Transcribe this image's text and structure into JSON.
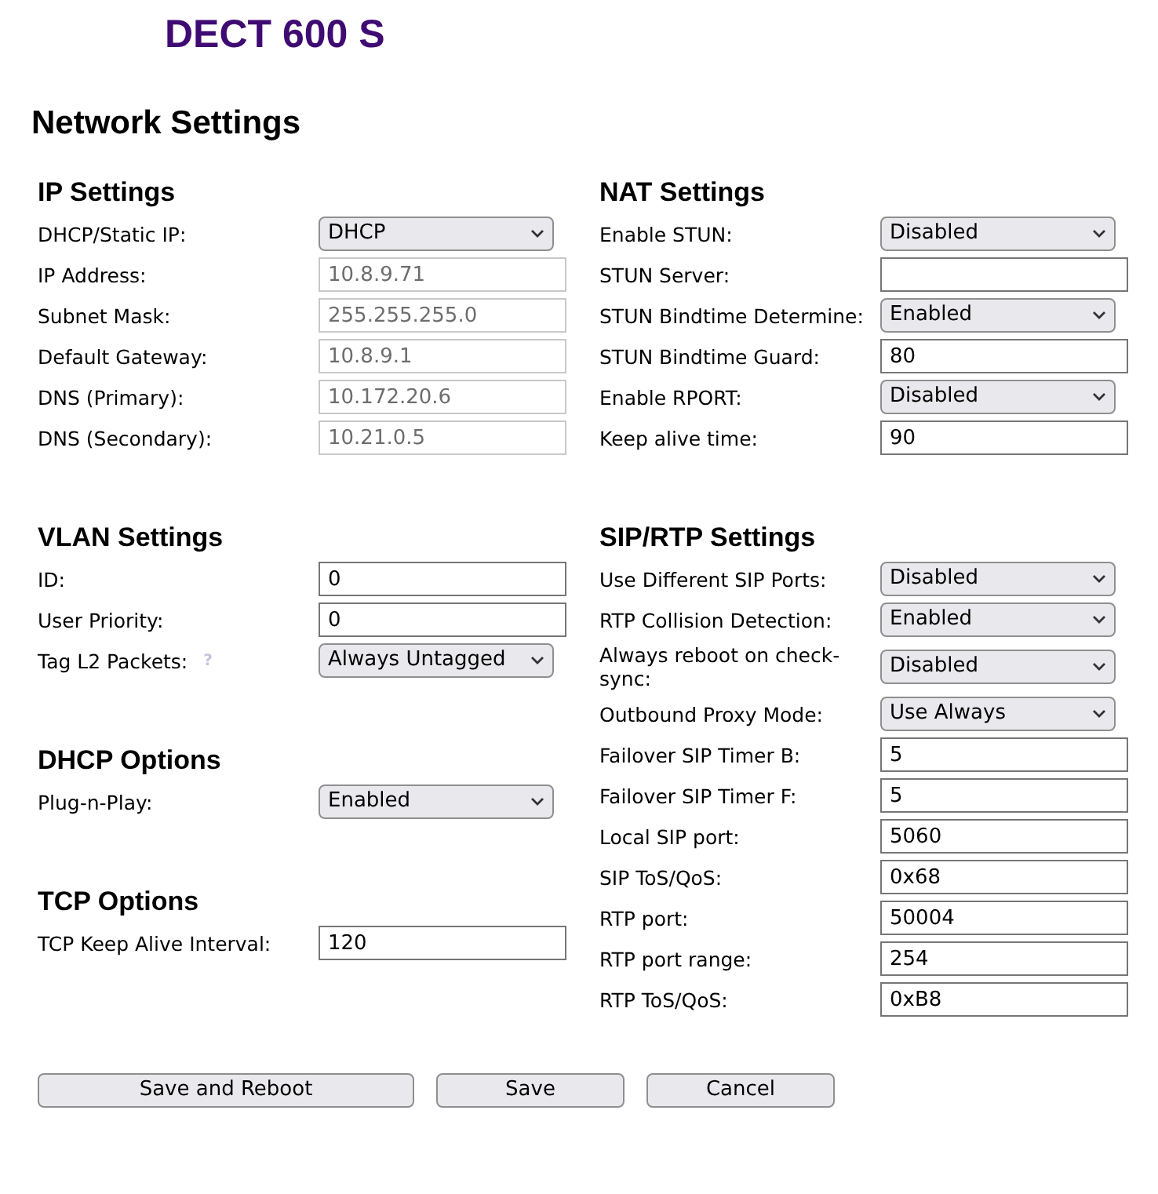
{
  "brand": "DECT 600 S",
  "page_title": "Network Settings",
  "columns": [
    [
      {
        "title": "IP Settings",
        "rows": [
          {
            "label": "DHCP/Static IP:",
            "kind": "select",
            "value": "DHCP"
          },
          {
            "label": "IP Address:",
            "kind": "input",
            "value": "10.8.9.71",
            "disabled": true
          },
          {
            "label": "Subnet Mask:",
            "kind": "input",
            "value": "255.255.255.0",
            "disabled": true
          },
          {
            "label": "Default Gateway:",
            "kind": "input",
            "value": "10.8.9.1",
            "disabled": true
          },
          {
            "label": "DNS (Primary):",
            "kind": "input",
            "value": "10.172.20.6",
            "disabled": true
          },
          {
            "label": "DNS (Secondary):",
            "kind": "input",
            "value": "10.21.0.5",
            "disabled": true
          }
        ]
      },
      {
        "title": "VLAN Settings",
        "rows": [
          {
            "label": "ID:",
            "kind": "input",
            "value": "0",
            "disabled": false
          },
          {
            "label": "User Priority:",
            "kind": "input",
            "value": "0",
            "disabled": false
          },
          {
            "label": "Tag L2 Packets:",
            "hint": "?",
            "kind": "select",
            "value": "Always Untagged"
          }
        ]
      },
      {
        "title": "DHCP Options",
        "rows": [
          {
            "label": "Plug-n-Play:",
            "kind": "select",
            "value": "Enabled"
          }
        ]
      },
      {
        "title": "TCP Options",
        "rows": [
          {
            "label": "TCP Keep Alive Interval:",
            "kind": "input",
            "value": "120",
            "disabled": false
          }
        ]
      }
    ],
    [
      {
        "title": "NAT Settings",
        "rows": [
          {
            "label": "Enable STUN:",
            "kind": "select",
            "value": "Disabled"
          },
          {
            "label": "STUN Server:",
            "kind": "input",
            "disabled": false
          },
          {
            "label": "STUN Bindtime Determine:",
            "kind": "select",
            "value": "Enabled"
          },
          {
            "label": "STUN Bindtime Guard:",
            "kind": "input",
            "value": "80",
            "disabled": false
          },
          {
            "label": "Enable RPORT:",
            "kind": "select",
            "value": "Disabled"
          },
          {
            "label": "Keep alive time:",
            "kind": "input",
            "value": "90",
            "disabled": false
          }
        ]
      },
      {
        "title": "SIP/RTP Settings",
        "rows": [
          {
            "label": "Use Different SIP Ports:",
            "kind": "select",
            "value": "Disabled"
          },
          {
            "label": "RTP Collision Detection:",
            "kind": "select",
            "value": "Enabled"
          },
          {
            "label": "Always reboot on check-sync:",
            "kind": "select",
            "value": "Disabled"
          },
          {
            "label": "Outbound Proxy Mode:",
            "kind": "select",
            "value": "Use Always"
          },
          {
            "label": "Failover SIP Timer B:",
            "kind": "input",
            "value": "5",
            "disabled": false
          },
          {
            "label": "Failover SIP Timer F:",
            "kind": "input",
            "value": "5",
            "disabled": false
          },
          {
            "label": "Local SIP port:",
            "kind": "input",
            "value": "5060",
            "disabled": false
          },
          {
            "label": "SIP ToS/QoS:",
            "kind": "input",
            "value": "0x68",
            "disabled": false
          },
          {
            "label": "RTP port:",
            "kind": "input",
            "value": "50004",
            "disabled": false
          },
          {
            "label": "RTP port range:",
            "kind": "input",
            "value": "254",
            "disabled": false
          },
          {
            "label": "RTP ToS/QoS:",
            "kind": "input",
            "value": "0xB8",
            "disabled": false
          }
        ]
      }
    ]
  ],
  "buttons": [
    "Save and Reboot",
    "Save",
    "Cancel"
  ]
}
